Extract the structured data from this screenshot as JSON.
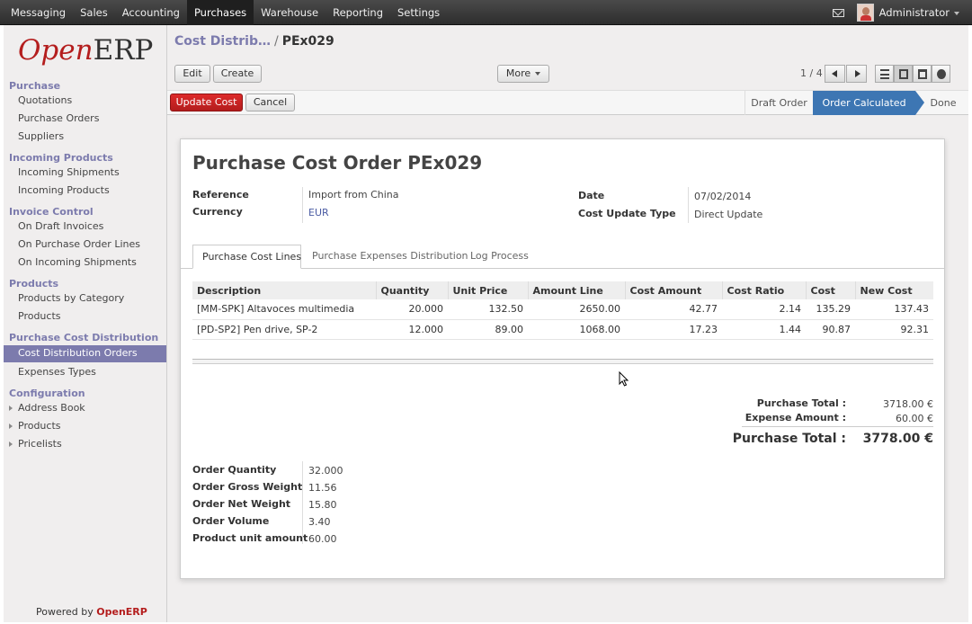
{
  "topnav": {
    "items": [
      "Messaging",
      "Sales",
      "Accounting",
      "Purchases",
      "Warehouse",
      "Reporting",
      "Settings"
    ],
    "user": "Administrator"
  },
  "logo": {
    "open": "Open",
    "erp": "ERP"
  },
  "sidebar": {
    "sec_purchase": "Purchase",
    "quotations": "Quotations",
    "purchase_orders": "Purchase Orders",
    "suppliers": "Suppliers",
    "sec_incoming": "Incoming Products",
    "incoming_shipments": "Incoming Shipments",
    "incoming_products": "Incoming Products",
    "sec_invoice": "Invoice Control",
    "on_draft_invoices": "On Draft Invoices",
    "on_po_lines": "On Purchase Order Lines",
    "on_incoming_shipments": "On Incoming Shipments",
    "sec_products": "Products",
    "products_by_category": "Products by Category",
    "products": "Products",
    "sec_pcd": "Purchase Cost Distribution",
    "cost_distribution_orders": "Cost Distribution Orders",
    "expenses_types": "Expenses Types",
    "sec_config": "Configuration",
    "address_book": "Address Book",
    "cfg_products": "Products",
    "pricelists": "Pricelists",
    "powered_prefix": "Powered by",
    "powered_brand": "OpenERP"
  },
  "breadcrumb": {
    "parent": "Cost Distrib…",
    "sep": "/",
    "current": "PEx029"
  },
  "toolbar": {
    "edit": "Edit",
    "create": "Create",
    "more": "More",
    "pager": "1 / 4"
  },
  "actions": {
    "update_cost": "Update Cost",
    "cancel": "Cancel"
  },
  "stages": [
    "Draft Order",
    "Order Calculated",
    "Done"
  ],
  "form": {
    "title": "Purchase Cost Order",
    "name": "PEx029",
    "reference_label": "Reference",
    "reference": "Import from China",
    "currency_label": "Currency",
    "currency": "EUR",
    "date_label": "Date",
    "date": "07/02/2014",
    "cost_update_type_label": "Cost Update Type",
    "cost_update_type": "Direct Update"
  },
  "tabs": [
    "Purchase Cost Lines",
    "Purchase Expenses Distribution",
    "Log Process"
  ],
  "lines": {
    "headers": [
      "Description",
      "Quantity",
      "Unit Price",
      "Amount Line",
      "Cost Amount",
      "Cost Ratio",
      "Cost",
      "New Cost"
    ],
    "rows": [
      [
        "[MM-SPK] Altavoces multimedia",
        "20.000",
        "132.50",
        "2650.00",
        "42.77",
        "2.14",
        "135.29",
        "137.43"
      ],
      [
        "[PD-SP2] Pen drive, SP-2",
        "12.000",
        "89.00",
        "1068.00",
        "17.23",
        "1.44",
        "90.87",
        "92.31"
      ]
    ]
  },
  "totals": {
    "purchase_total_label": "Purchase Total :",
    "purchase_total": "3718.00 €",
    "expense_amount_label": "Expense Amount :",
    "expense_amount": "60.00 €",
    "grand_total_label": "Purchase Total :",
    "grand_total": "3778.00 €"
  },
  "summary": {
    "order_quantity_label": "Order Quantity",
    "order_quantity": "32.000",
    "gross_weight_label": "Order Gross Weight",
    "gross_weight": "11.56",
    "net_weight_label": "Order Net Weight",
    "net_weight": "15.80",
    "volume_label": "Order Volume",
    "volume": "3.40",
    "unit_amount_label": "Product unit amount",
    "unit_amount": "60.00"
  }
}
